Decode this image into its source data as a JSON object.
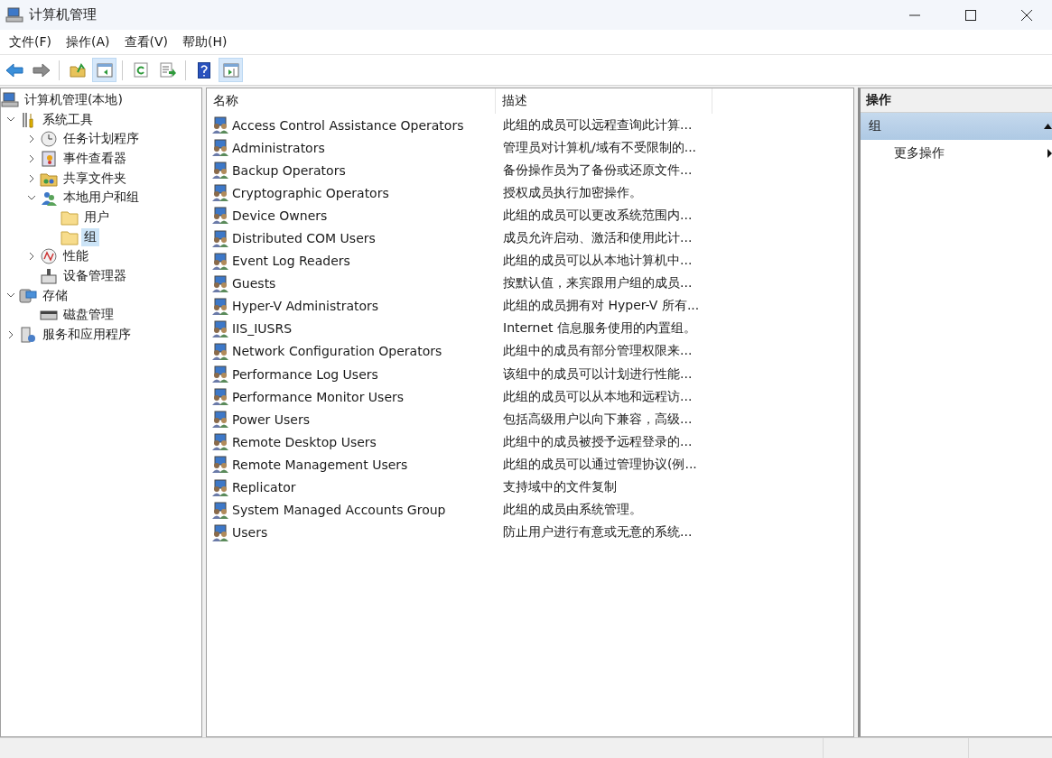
{
  "window": {
    "title": "计算机管理"
  },
  "menu": [
    "文件(F)",
    "操作(A)",
    "查看(V)",
    "帮助(H)"
  ],
  "toolbar": [
    {
      "kind": "back",
      "pressed": false
    },
    {
      "kind": "forward",
      "pressed": false
    },
    {
      "kind": "sep"
    },
    {
      "kind": "up",
      "pressed": false
    },
    {
      "kind": "tree",
      "pressed": true
    },
    {
      "kind": "sep"
    },
    {
      "kind": "refresh",
      "pressed": false
    },
    {
      "kind": "export",
      "pressed": false
    },
    {
      "kind": "sep"
    },
    {
      "kind": "help",
      "pressed": false
    },
    {
      "kind": "pane",
      "pressed": true
    }
  ],
  "tree": [
    {
      "label": "计算机管理(本地)",
      "kind": "computer",
      "selected": false,
      "children": [
        {
          "label": "系统工具",
          "kind": "tools",
          "expanded": true,
          "selected": false,
          "children": [
            {
              "label": "任务计划程序",
              "kind": "clock",
              "expanded": false,
              "selected": false
            },
            {
              "label": "事件查看器",
              "kind": "event",
              "expanded": false,
              "selected": false
            },
            {
              "label": "共享文件夹",
              "kind": "share",
              "expanded": false,
              "selected": false
            },
            {
              "label": "本地用户和组",
              "kind": "users",
              "expanded": true,
              "selected": false,
              "children": [
                {
                  "label": "用户",
                  "kind": "folder",
                  "selected": false
                },
                {
                  "label": "组",
                  "kind": "folder",
                  "selected": true
                }
              ]
            },
            {
              "label": "性能",
              "kind": "perf",
              "expanded": false,
              "selected": false
            },
            {
              "label": "设备管理器",
              "kind": "device",
              "selected": false
            }
          ]
        },
        {
          "label": "存储",
          "kind": "storage",
          "expanded": true,
          "selected": false,
          "children": [
            {
              "label": "磁盘管理",
              "kind": "disk",
              "selected": false
            }
          ]
        },
        {
          "label": "服务和应用程序",
          "kind": "services",
          "expanded": false,
          "selected": false
        }
      ]
    }
  ],
  "table": {
    "columns": [
      "名称",
      "描述"
    ],
    "rows": [
      {
        "name": "Access Control Assistance Operators",
        "description": "此组的成员可以远程查询此计算..."
      },
      {
        "name": "Administrators",
        "description": "管理员对计算机/域有不受限制的..."
      },
      {
        "name": "Backup Operators",
        "description": "备份操作员为了备份或还原文件..."
      },
      {
        "name": "Cryptographic Operators",
        "description": "授权成员执行加密操作。"
      },
      {
        "name": "Device Owners",
        "description": "此组的成员可以更改系统范围内..."
      },
      {
        "name": "Distributed COM Users",
        "description": "成员允许启动、激活和使用此计..."
      },
      {
        "name": "Event Log Readers",
        "description": "此组的成员可以从本地计算机中..."
      },
      {
        "name": "Guests",
        "description": "按默认值，来宾跟用户组的成员..."
      },
      {
        "name": "Hyper-V Administrators",
        "description": "此组的成员拥有对 Hyper-V 所有..."
      },
      {
        "name": "IIS_IUSRS",
        "description": "Internet 信息服务使用的内置组。"
      },
      {
        "name": "Network Configuration Operators",
        "description": "此组中的成员有部分管理权限来..."
      },
      {
        "name": "Performance Log Users",
        "description": "该组中的成员可以计划进行性能..."
      },
      {
        "name": "Performance Monitor Users",
        "description": "此组的成员可以从本地和远程访..."
      },
      {
        "name": "Power Users",
        "description": "包括高级用户以向下兼容，高级..."
      },
      {
        "name": "Remote Desktop Users",
        "description": "此组中的成员被授予远程登录的..."
      },
      {
        "name": "Remote Management Users",
        "description": "此组的成员可以通过管理协议(例..."
      },
      {
        "name": "Replicator",
        "description": "支持域中的文件复制"
      },
      {
        "name": "System Managed Accounts Group",
        "description": "此组的成员由系统管理。"
      },
      {
        "name": "Users",
        "description": "防止用户进行有意或无意的系统..."
      }
    ]
  },
  "actions": {
    "title": "操作",
    "section": {
      "label": "组",
      "expanded": true
    },
    "items": [
      "更多操作"
    ]
  }
}
